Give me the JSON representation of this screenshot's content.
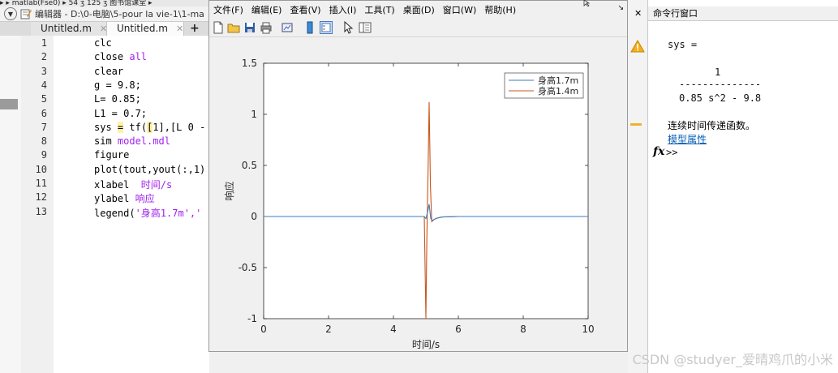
{
  "breadcrumb": {
    "text": "▸ ▸ matlab(Fse0) ▸ 54 ʒ 125 ʒ 图书馆课堂 ▸"
  },
  "editor": {
    "title": "编辑器 - D:\\0-电脑\\5-pour la vie-1\\1-ma",
    "tabs": [
      {
        "label": "Untitled.m"
      },
      {
        "label": "Untitled.m"
      }
    ],
    "close_glyph": "✕",
    "add_tab": "+",
    "lines": [
      {
        "n": "1",
        "parts": [
          {
            "t": "clc",
            "c": ""
          }
        ]
      },
      {
        "n": "2",
        "parts": [
          {
            "t": "close ",
            "c": ""
          },
          {
            "t": "all",
            "c": "kw"
          }
        ]
      },
      {
        "n": "3",
        "parts": [
          {
            "t": "clear",
            "c": ""
          }
        ]
      },
      {
        "n": "4",
        "parts": [
          {
            "t": "g = 9.8;",
            "c": ""
          }
        ]
      },
      {
        "n": "5",
        "parts": [
          {
            "t": "L= 0.85;",
            "c": ""
          }
        ]
      },
      {
        "n": "6",
        "parts": [
          {
            "t": "L1 = 0.7;",
            "c": ""
          }
        ]
      },
      {
        "n": "7",
        "parts": [
          {
            "t": "sys ",
            "c": ""
          },
          {
            "t": "=",
            "c": "hl"
          },
          {
            "t": " tf(",
            "c": ""
          },
          {
            "t": "[",
            "c": "hl"
          },
          {
            "t": "1],[L 0 -",
            "c": ""
          }
        ]
      },
      {
        "n": "8",
        "parts": [
          {
            "t": "sim ",
            "c": ""
          },
          {
            "t": "model.mdl",
            "c": "kw"
          }
        ]
      },
      {
        "n": "9",
        "parts": [
          {
            "t": "figure",
            "c": ""
          }
        ]
      },
      {
        "n": "10",
        "parts": [
          {
            "t": "plot(tout,yout(:,1)",
            "c": ""
          }
        ]
      },
      {
        "n": "11",
        "parts": [
          {
            "t": "xlabel  ",
            "c": ""
          },
          {
            "t": "时间/s",
            "c": "kw"
          }
        ]
      },
      {
        "n": "12",
        "parts": [
          {
            "t": "ylabel ",
            "c": ""
          },
          {
            "t": "响应",
            "c": "kw"
          }
        ]
      },
      {
        "n": "13",
        "parts": [
          {
            "t": "legend(",
            "c": ""
          },
          {
            "t": "'身高1.7m','",
            "c": "kw"
          }
        ]
      }
    ]
  },
  "figure": {
    "menu": [
      "文件(F)",
      "编辑(E)",
      "查看(V)",
      "插入(I)",
      "工具(T)",
      "桌面(D)",
      "窗口(W)",
      "帮助(H)"
    ],
    "dock_glyph": "↘"
  },
  "command_window": {
    "title": "命令行窗口",
    "close_glyph": "✕",
    "lines": [
      "sys =",
      "1",
      "--------------",
      "0.85 s^2 - 9.8"
    ],
    "desc": "连续时间传递函数。",
    "link": "模型属性",
    "fx": "fx",
    "prompt": ">>"
  },
  "watermark": "CSDN @studyer_爱晴鸡爪的小米",
  "colors": {
    "series1": "#3a7fbf",
    "series2": "#c8551b",
    "keyword": "#a020f0",
    "link": "#0a5fb4"
  },
  "chart_data": {
    "type": "line",
    "xlabel": "时间/s",
    "ylabel": "响应",
    "xlim": [
      0,
      10
    ],
    "ylim": [
      -1,
      1.5
    ],
    "xticks": [
      0,
      2,
      4,
      6,
      8,
      10
    ],
    "yticks": [
      -1,
      -0.5,
      0,
      0.5,
      1,
      1.5
    ],
    "legend_position": "top-right",
    "grid": false,
    "series": [
      {
        "name": "身高1.7m",
        "color": "#3a7fbf",
        "x": [
          0,
          4.95,
          5.0,
          5.05,
          5.1,
          5.15,
          5.2,
          5.3,
          5.5,
          6.0,
          10
        ],
        "y": [
          0,
          0,
          -0.02,
          0.04,
          0.12,
          -0.02,
          -0.04,
          -0.02,
          -0.005,
          0,
          0
        ]
      },
      {
        "name": "身高1.4m",
        "color": "#c8551b",
        "x": [
          0,
          4.95,
          5.0,
          5.03,
          5.07,
          5.1,
          5.14,
          5.18,
          5.25,
          5.35,
          5.5,
          6.0,
          10
        ],
        "y": [
          0,
          0,
          -1.0,
          -0.2,
          0.5,
          1.12,
          0.3,
          -0.05,
          -0.03,
          -0.015,
          -0.005,
          0,
          0
        ]
      }
    ]
  }
}
